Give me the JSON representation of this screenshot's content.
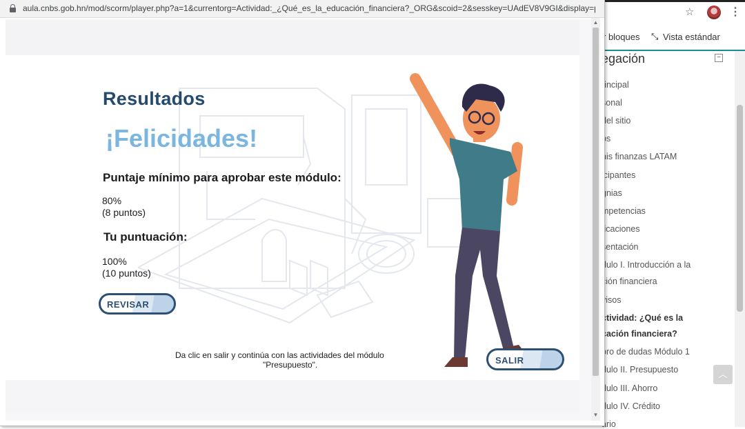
{
  "background_browser": {
    "toolbar": {
      "blocks_label": "r bloques",
      "standard_view_label": "Vista estándar"
    },
    "nav_title": "egación",
    "nav_items": [
      {
        "label": "rincipal",
        "bold": false
      },
      {
        "label": "sonal",
        "bold": false
      },
      {
        "label": "del sitio",
        "bold": false
      },
      {
        "label": "os",
        "bold": false
      },
      {
        "label": "nis finanzas LATAM",
        "bold": false
      },
      {
        "label": "icipantes",
        "bold": false
      },
      {
        "label": "gnias",
        "bold": false
      },
      {
        "label": "mpetencias",
        "bold": false
      },
      {
        "label": "ficaciones",
        "bold": false
      },
      {
        "label": "sentación",
        "bold": false
      },
      {
        "label": "dulo I. Introducción a la",
        "bold": false
      },
      {
        "label": "ción financiera",
        "bold": false
      },
      {
        "label": "visos",
        "bold": false
      },
      {
        "label": "ctividad: ¿Qué es la",
        "bold": true
      },
      {
        "label": "cación financiera?",
        "bold": true
      },
      {
        "label": "oro de dudas Módulo 1",
        "bold": false
      },
      {
        "label": "dulo II. Presupuesto",
        "bold": false
      },
      {
        "label": "dulo III. Ahorro",
        "bold": false
      },
      {
        "label": "dulo IV. Crédito",
        "bold": false
      },
      {
        "label": "ario",
        "bold": false
      }
    ]
  },
  "popup": {
    "url": "aula.cnbs.gob.hn/mod/scorm/player.php?a=1&currentorg=Actividad:_¿Qué_es_la_educación_financiera?_ORG&scoid=2&sesskey=UAdEV8V9GI&display=p..."
  },
  "slide": {
    "title": "Resultados",
    "congrats": "¡Felicidades!",
    "min_score_label": "Puntaje mínimo para aprobar este módulo:",
    "min_score_percent": "80%",
    "min_score_points": "(8 puntos)",
    "your_score_label": "Tu puntuación:",
    "your_score_percent": "100%",
    "your_score_points": "(10 puntos)",
    "review_button": "REVISAR",
    "exit_button": "SALIR",
    "footer_line1": "Da clic en salir y continúa con las actividades del módulo",
    "footer_line2": "\"Presupuesto\"."
  },
  "colors": {
    "title": "#244a6e",
    "congrats": "#7bb6df",
    "button_border": "#2d4f72",
    "nav_accent": "#1a8c8c"
  }
}
